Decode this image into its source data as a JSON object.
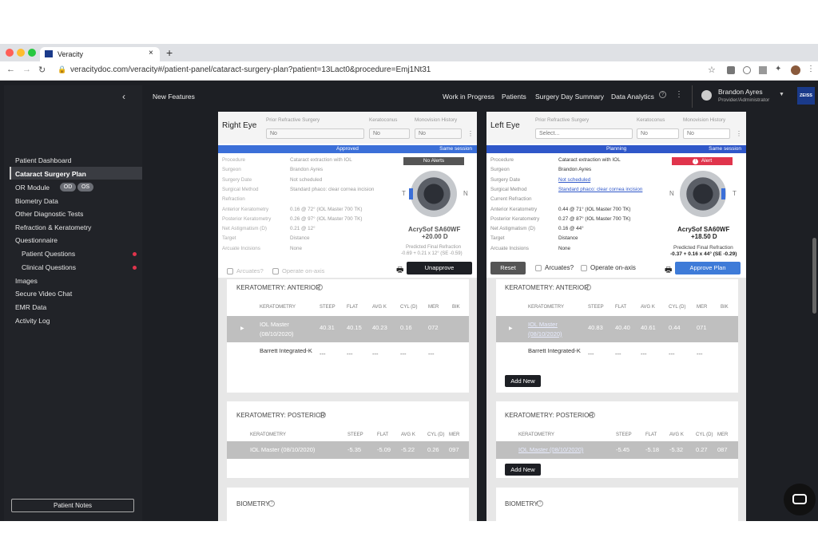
{
  "browser": {
    "tab_title": "Veracity",
    "url": "veracitydoc.com/veracity#/patient-panel/cataract-surgery-plan?patient=13Lact0&procedure=Emj1Nt31"
  },
  "sidebar": {
    "items": [
      "Patient Dashboard",
      "Cataract Surgery Plan",
      "OR Module",
      "Biometry Data",
      "Other Diagnostic Tests",
      "Refraction & Keratometry",
      "Questionnaire",
      "Patient Questions",
      "Clinical Questions",
      "Images",
      "Secure Video Chat",
      "EMR Data",
      "Activity Log"
    ],
    "od": "OD",
    "os": "OS",
    "notes_button": "Patient Notes"
  },
  "topbar": {
    "new_features": "New Features",
    "nav": [
      "Work in Progress",
      "Patients",
      "Surgery Day Summary",
      "Data Analytics"
    ],
    "user_name": "Brandon Ayres",
    "user_role": "Provider/Administrator",
    "brand": "ZEISS"
  },
  "right_eye": {
    "title": "Right Eye",
    "prior_label": "Prior Refractive Surgery",
    "prior_value": "No",
    "kerato_label": "Keratoconus",
    "kerato_value": "No",
    "mono_label": "Monovision History",
    "mono_value": "No",
    "status": "Approved",
    "session": "Same session",
    "fields": [
      [
        "Procedure",
        "Cataract extraction with IOL"
      ],
      [
        "Surgeon",
        "Brandon Ayres"
      ],
      [
        "Surgery Date",
        "Not scheduled"
      ],
      [
        "Surgical Method",
        "Standard phaco: clear cornea incision"
      ],
      [
        "Refraction",
        ""
      ],
      [
        "Anterior Keratometry",
        "0.16 @ 72° (IOL Master 700 TK)"
      ],
      [
        "Posterior Keratometry",
        "0.26 @ 97° (IOL Master 700 TK)"
      ],
      [
        "Net Astigmatism (D)",
        "0.21 @ 12°"
      ],
      [
        "Target",
        "Distance"
      ],
      [
        "Arcuate Incisions",
        "None"
      ]
    ],
    "alert": "No Alerts",
    "lens": "AcrySof SA60WF",
    "power": "+20.00 D",
    "pred_label": "Predicted Final Refraction",
    "pred_value": "-0.69 + 0.21 x 12° (SE -0.59)",
    "arcuates": "Arcuates?",
    "on_axis": "Operate on-axis",
    "action": "Unapprove"
  },
  "left_eye": {
    "title": "Left Eye",
    "prior_label": "Prior Refractive Surgery",
    "prior_value": "Select...",
    "kerato_label": "Keratoconus",
    "kerato_value": "No",
    "mono_label": "Monovision History",
    "mono_value": "No",
    "status": "Planning",
    "session": "Same session",
    "fields": [
      [
        "Procedure",
        "Cataract extraction with IOL"
      ],
      [
        "Surgeon",
        "Brandon Ayres"
      ],
      [
        "Surgery Date",
        "Not scheduled"
      ],
      [
        "Surgical Method",
        "Standard phaco: clear cornea incision"
      ],
      [
        "Current Refraction",
        ""
      ],
      [
        "Anterior Keratometry",
        "0.44 @ 71° (IOL Master 700 TK)"
      ],
      [
        "Posterior Keratometry",
        "0.27 @ 87° (IOL Master 700 TK)"
      ],
      [
        "Net Astigmatism (D)",
        "0.16 @ 44°"
      ],
      [
        "Target",
        "Distance"
      ],
      [
        "Arcuate Incisions",
        "None"
      ]
    ],
    "alert": "Alert",
    "lens": "AcrySof SA60WF",
    "power": "+18.50 D",
    "pred_label": "Predicted Final Refraction",
    "pred_value": "-0.37 + 0.16 x 44° (SE -0.29)",
    "reset": "Reset",
    "arcuates": "Arcuates?",
    "on_axis": "Operate on-axis",
    "action": "Approve Plan"
  },
  "kera_anterior": {
    "title": "KERATOMETRY: ANTERIOR",
    "headers": [
      "KERATOMETRY",
      "STEEP",
      "FLAT",
      "AVG K",
      "CYL (D)",
      "MER",
      "BIK"
    ],
    "right_rows": [
      [
        "IOL Master (08/10/2020)",
        "40.31",
        "40.15",
        "40.23",
        "0.16",
        "072"
      ],
      [
        "Barrett Integrated-K",
        "---",
        "---",
        "---",
        "---",
        "---"
      ]
    ],
    "left_rows": [
      [
        "IOL Master (08/10/2020)",
        "40.83",
        "40.40",
        "40.61",
        "0.44",
        "071"
      ],
      [
        "Barrett Integrated-K",
        "---",
        "---",
        "---",
        "---",
        "---"
      ]
    ]
  },
  "kera_posterior": {
    "title": "KERATOMETRY: POSTERIOR",
    "headers": [
      "KERATOMETRY",
      "STEEP",
      "FLAT",
      "AVG K",
      "CYL (D)",
      "MER"
    ],
    "right_row": [
      "IOL Master (08/10/2020)",
      "-5.35",
      "-5.09",
      "-5.22",
      "0.26",
      "097"
    ],
    "left_row": [
      "IOL Master (08/10/2020)",
      "-5.45",
      "-5.18",
      "-5.32",
      "0.27",
      "087"
    ]
  },
  "add_new": "Add New",
  "biometry": "BIOMETRY",
  "colors": {
    "approved": "#3b6fd8",
    "planning": "#2f57c9",
    "alert": "#e0344c"
  }
}
